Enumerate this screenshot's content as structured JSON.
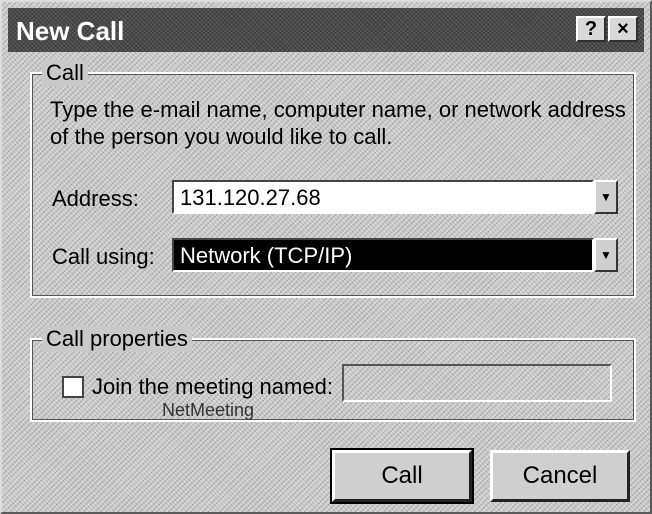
{
  "window": {
    "title": "New Call",
    "help_glyph": "?",
    "close_glyph": "×"
  },
  "call_group": {
    "legend": "Call",
    "description": "Type the e-mail name, computer name, or network address of the person you would like to call.",
    "address_label": "Address:",
    "address_value": "131.120.27.68",
    "call_using_label": "Call using:",
    "call_using_value": "Network (TCP/IP)",
    "dropdown_glyph": "▼"
  },
  "call_properties": {
    "legend": "Call properties",
    "join_label": "Join the meeting named:",
    "join_sub": "NetMeeting",
    "checked": false
  },
  "buttons": {
    "call": "Call",
    "cancel": "Cancel"
  }
}
